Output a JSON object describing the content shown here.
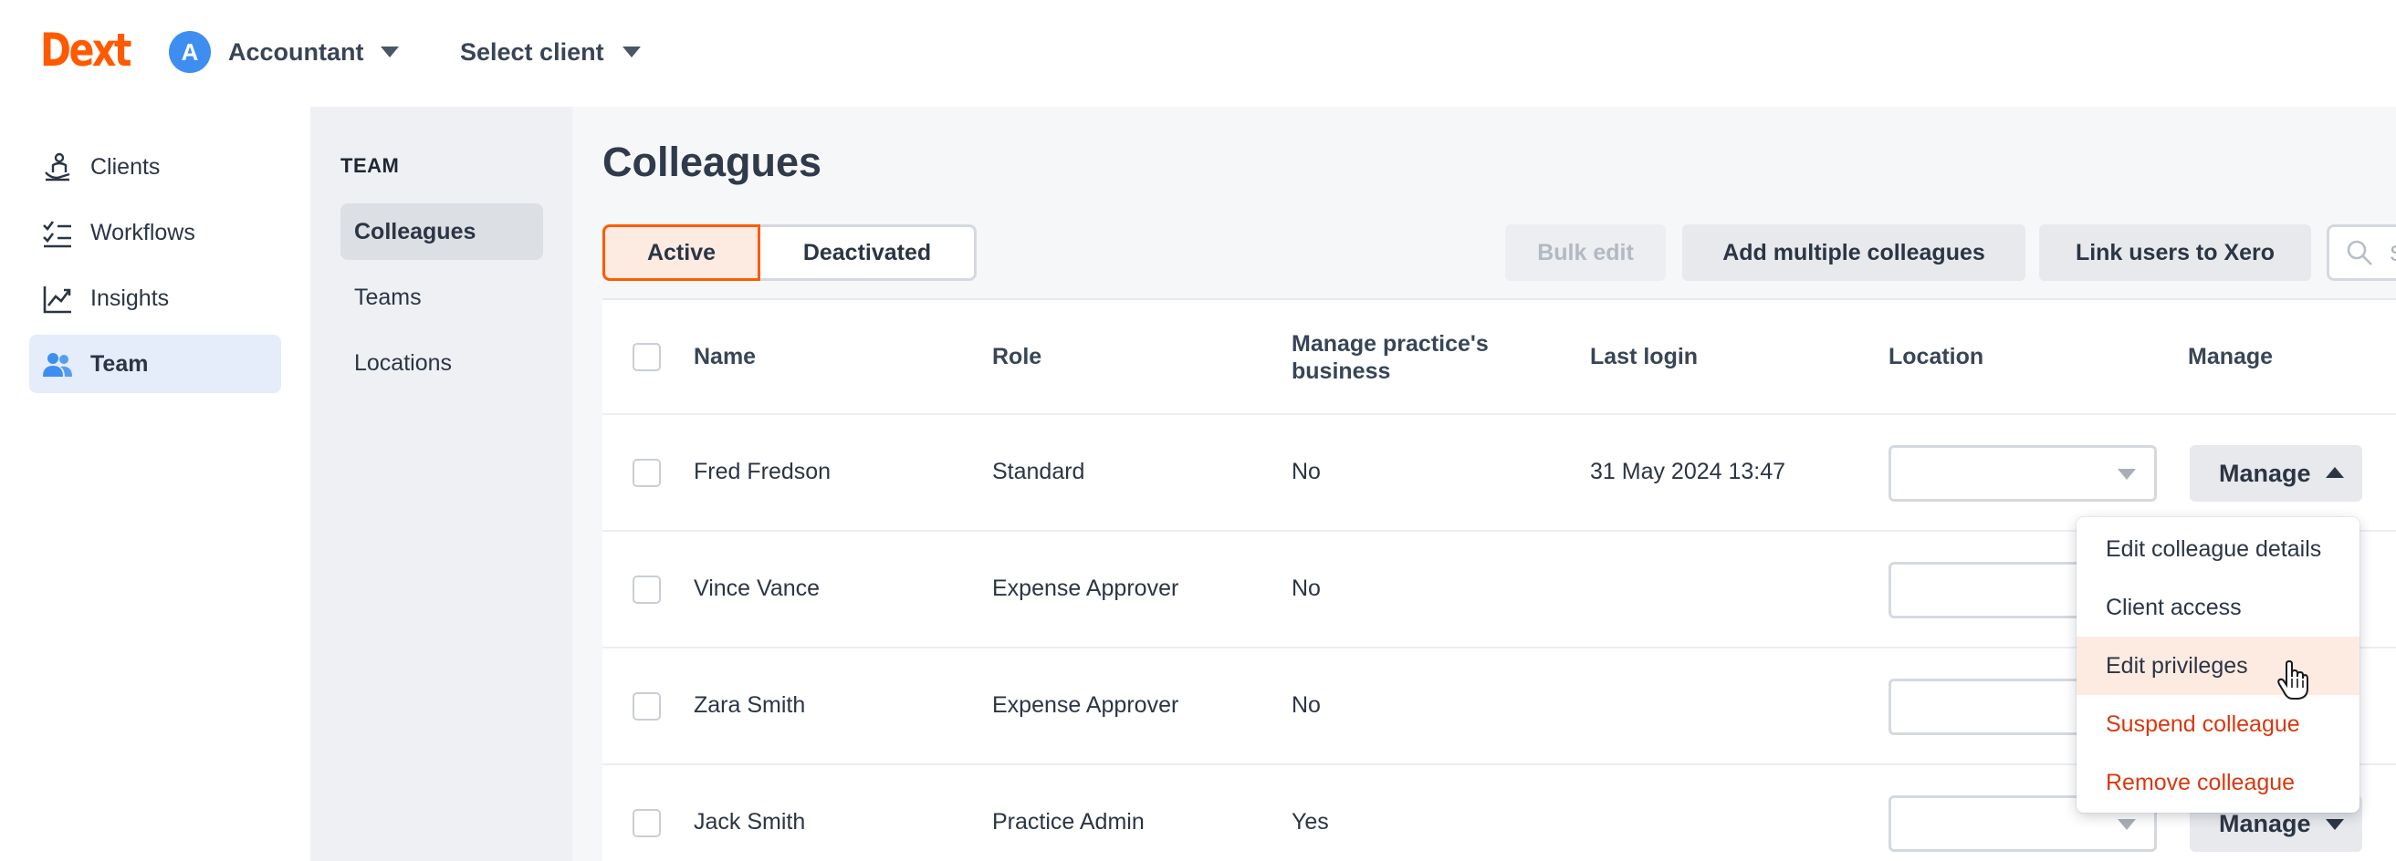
{
  "brand": {
    "logo": "Dext",
    "color": "#ff5a00"
  },
  "account": {
    "initial": "A",
    "label": "Accountant"
  },
  "client_selector": {
    "label": "Select client"
  },
  "left_nav": [
    {
      "label": "Clients",
      "icon": "clients-icon"
    },
    {
      "label": "Workflows",
      "icon": "workflows-icon"
    },
    {
      "label": "Insights",
      "icon": "insights-icon"
    },
    {
      "label": "Team",
      "icon": "team-icon",
      "active": true
    }
  ],
  "sub_nav": {
    "heading": "TEAM",
    "items": [
      {
        "label": "Colleagues",
        "active": true
      },
      {
        "label": "Teams"
      },
      {
        "label": "Locations"
      }
    ]
  },
  "main": {
    "title": "Colleagues",
    "segments": {
      "active": "Active",
      "deactivated": "Deactivated"
    },
    "toolbar": {
      "bulk_edit": "Bulk edit",
      "add_multiple": "Add multiple colleagues",
      "link_xero": "Link users to Xero",
      "search_placeholder": "S"
    }
  },
  "table": {
    "headers": {
      "name": "Name",
      "role": "Role",
      "manage_business": "Manage practice's business",
      "last_login": "Last login",
      "location": "Location",
      "manage": "Manage"
    },
    "rows": [
      {
        "name": "Fred Fredson",
        "role": "Standard",
        "manage_business": "No",
        "last_login": "31 May 2024 13:47",
        "manage": "Manage"
      },
      {
        "name": "Vince Vance",
        "role": "Expense Approver",
        "manage_business": "No",
        "last_login": ""
      },
      {
        "name": "Zara Smith",
        "role": "Expense Approver",
        "manage_business": "No",
        "last_login": ""
      },
      {
        "name": "Jack Smith",
        "role": "Practice Admin",
        "manage_business": "Yes",
        "last_login": "",
        "manage": "Manage"
      }
    ]
  },
  "manage_menu": {
    "items": [
      {
        "label": "Edit colleague details"
      },
      {
        "label": "Client access"
      },
      {
        "label": "Edit privileges",
        "hover": true
      },
      {
        "label": "Suspend colleague",
        "danger": true
      },
      {
        "label": "Remove colleague",
        "danger": true
      }
    ]
  }
}
